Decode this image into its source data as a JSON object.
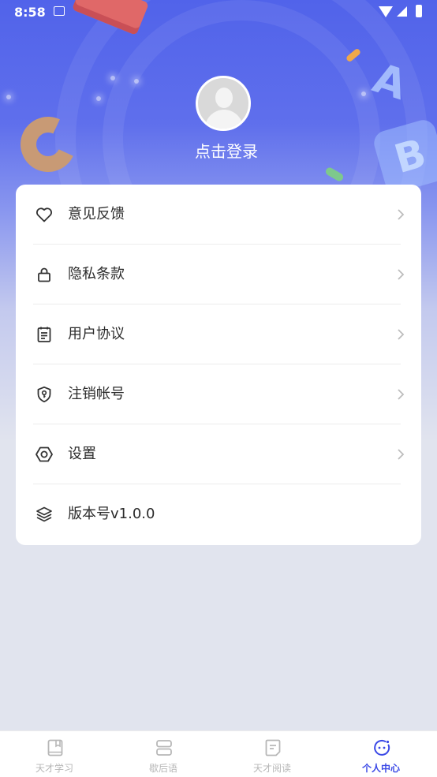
{
  "status_bar": {
    "time": "8:58"
  },
  "profile": {
    "login_text": "点击登录"
  },
  "menu": [
    {
      "label": "意见反馈",
      "icon": "heart-icon",
      "chevron": true
    },
    {
      "label": "隐私条款",
      "icon": "lock-icon",
      "chevron": true
    },
    {
      "label": "用户协议",
      "icon": "document-icon",
      "chevron": true
    },
    {
      "label": "注销帐号",
      "icon": "shield-key-icon",
      "chevron": true
    },
    {
      "label": "设置",
      "icon": "hexagon-settings-icon",
      "chevron": true
    },
    {
      "label": "版本号v1.0.0",
      "icon": "layers-icon",
      "chevron": false
    }
  ],
  "tabbar": {
    "tabs": [
      {
        "label": "天才学习",
        "icon": "book-icon",
        "active": false
      },
      {
        "label": "歇后语",
        "icon": "stack-icon",
        "active": false
      },
      {
        "label": "天才阅读",
        "icon": "reading-icon",
        "active": false
      },
      {
        "label": "个人中心",
        "icon": "smiley-icon",
        "active": true
      }
    ]
  },
  "colors": {
    "accent": "#3b49e6",
    "hero_top": "#5163ea",
    "page_bg": "#e1e4ee",
    "inactive": "#b7b7b7"
  }
}
